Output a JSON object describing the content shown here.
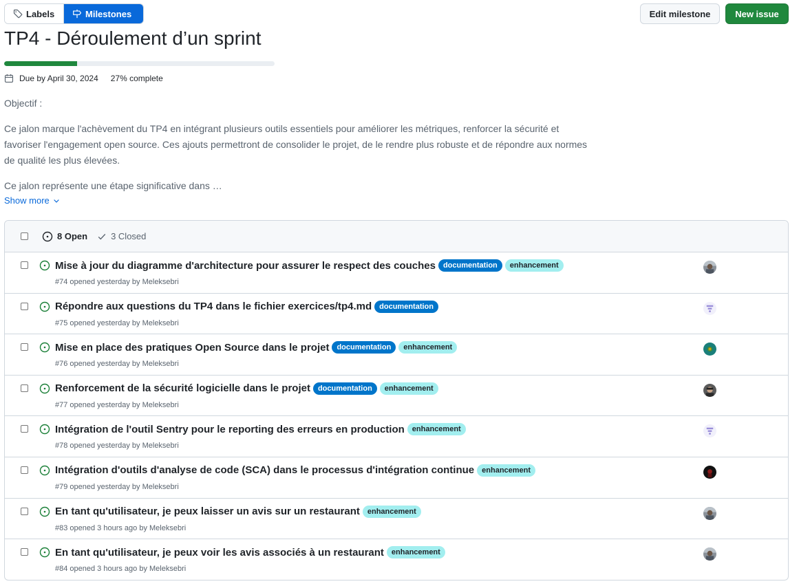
{
  "toolbar": {
    "labels_label": "Labels",
    "milestones_label": "Milestones",
    "edit_label": "Edit milestone",
    "new_issue_label": "New issue"
  },
  "milestone": {
    "title": "TP4 - Déroulement d’un sprint",
    "progress_percent": 27,
    "due": "Due by April 30, 2024",
    "percent_value": "27%",
    "percent_suffix": " complete",
    "objectif": "Objectif :",
    "description": "Ce jalon marque l'achèvement du TP4 en intégrant plusieurs outils essentiels pour améliorer les métriques, renforcer la sécurité et favoriser l'engagement open source. Ces ajouts permettront de consolider le projet, de le rendre plus robuste et de répondre aux normes de qualité les plus élevées.",
    "teaser": "Ce jalon représente une étape significative dans …",
    "show_more": "Show more"
  },
  "filters": {
    "open_label": "8 Open",
    "closed_label": "3 Closed"
  },
  "issues": [
    {
      "title": "Mise à jour du diagramme d'architecture pour assurer le respect des couches",
      "labels": [
        "documentation",
        "enhancement"
      ],
      "meta": "#74 opened yesterday by ",
      "author": "Meleksebri",
      "avatar": "photo-gray"
    },
    {
      "title": "Répondre aux questions du TP4 dans le fichier exercices/tp4.md",
      "labels": [
        "documentation"
      ],
      "meta": "#75 opened yesterday by ",
      "author": "Meleksebri",
      "avatar": "identicon-purple"
    },
    {
      "title": "Mise en place des pratiques Open Source dans le projet",
      "labels": [
        "documentation",
        "enhancement"
      ],
      "meta": "#76 opened yesterday by ",
      "author": "Meleksebri",
      "avatar": "photo-teal"
    },
    {
      "title": "Renforcement de la sécurité logicielle dans le projet",
      "labels": [
        "documentation",
        "enhancement"
      ],
      "meta": "#77 opened yesterday by ",
      "author": "Meleksebri",
      "avatar": "photo-dark"
    },
    {
      "title": "Intégration de l'outil Sentry pour le reporting des erreurs en production",
      "labels": [
        "enhancement"
      ],
      "meta": "#78 opened yesterday by ",
      "author": "Meleksebri",
      "avatar": "identicon-purple"
    },
    {
      "title": "Intégration d'outils d'analyse de code (SCA) dans le processus d'intégration continue",
      "labels": [
        "enhancement"
      ],
      "meta": "#79 opened yesterday by ",
      "author": "Meleksebri",
      "avatar": "photo-red"
    },
    {
      "title": "En tant qu'utilisateur, je peux laisser un avis sur un restaurant",
      "labels": [
        "enhancement"
      ],
      "meta": "#83 opened 3 hours ago by ",
      "author": "Meleksebri",
      "avatar": "photo-gray"
    },
    {
      "title": "En tant qu'utilisateur, je peux voir les avis associés à un restaurant",
      "labels": [
        "enhancement"
      ],
      "meta": "#84 opened 3 hours ago by ",
      "author": "Meleksebri",
      "avatar": "photo-gray"
    }
  ],
  "colors": {
    "accent": "#0969da",
    "success": "#1f883d",
    "documentation": "#0075ca",
    "enhancement": "#a2eeef"
  }
}
